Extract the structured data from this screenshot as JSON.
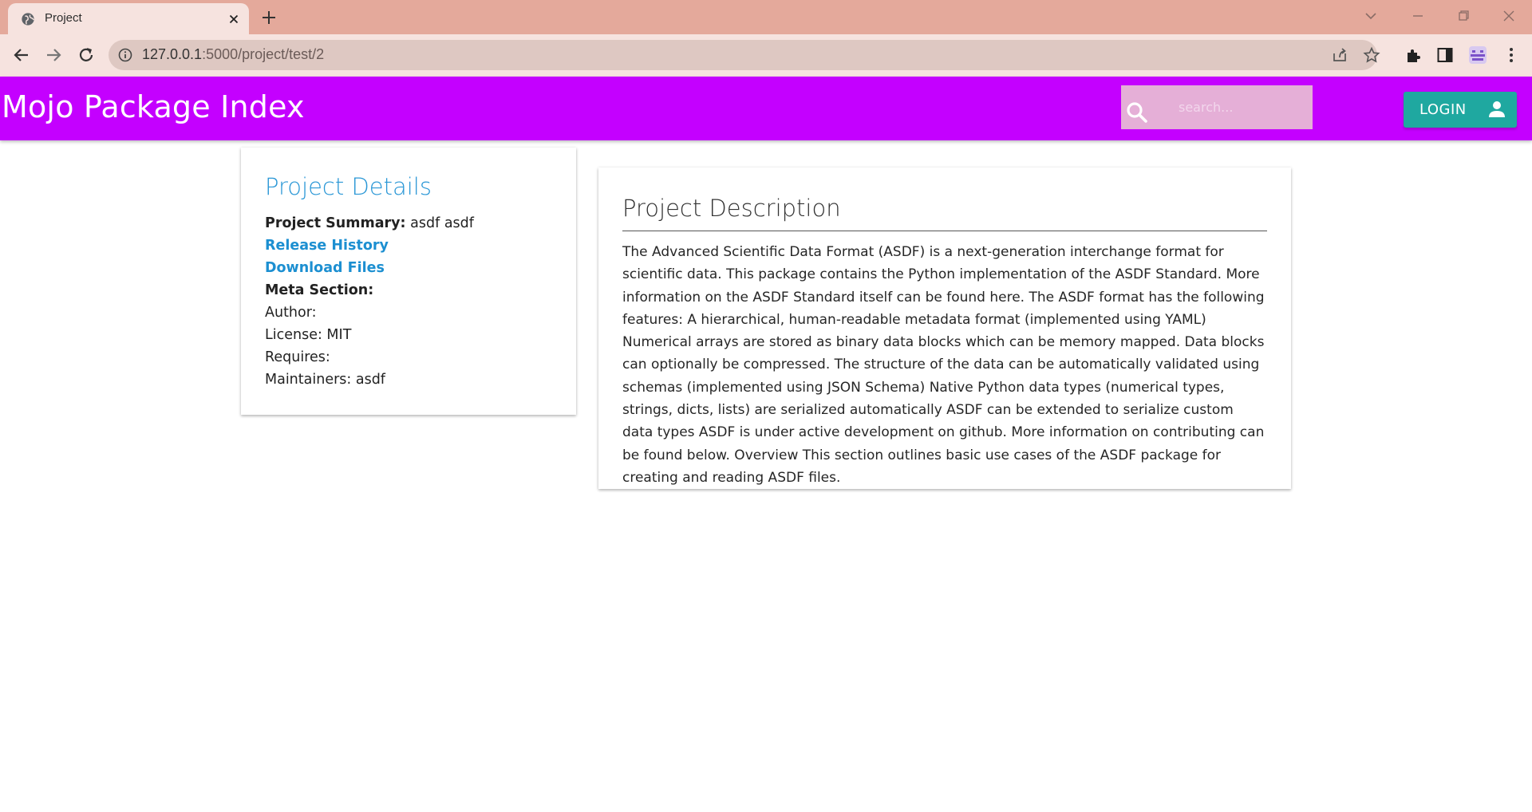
{
  "browser": {
    "tab_title": "Project",
    "url_host": "127.0.0.1",
    "url_path": ":5000/project/test/2"
  },
  "header": {
    "brand": "Mojo Package Index",
    "search_placeholder": "search...",
    "login_label": "LOGIN"
  },
  "details": {
    "title": "Project Details",
    "summary_label": "Project Summary:",
    "summary_value": "asdf asdf",
    "release_history": "Release History",
    "download_files": "Download Files",
    "meta_label": "Meta Section:",
    "author": "Author:",
    "license": "License: MIT",
    "requires": "Requires:",
    "maintainers": "Maintainers: asdf"
  },
  "description": {
    "title": "Project Description",
    "text": "The Advanced Scientific Data Format (ASDF) is a next-generation interchange format for scientific data. This package contains the Python implementation of the ASDF Standard. More information on the ASDF Standard itself can be found here. The ASDF format has the following features: A hierarchical, human-readable metadata format (implemented using YAML) Numerical arrays are stored as binary data blocks which can be memory mapped. Data blocks can optionally be compressed. The structure of the data can be automatically validated using schemas (implemented using JSON Schema) Native Python data types (numerical types, strings, dicts, lists) are serialized automatically ASDF can be extended to serialize custom data types ASDF is under active development on github. More information on contributing can be found below. Overview This section outlines basic use cases of the ASDF package for creating and reading ASDF files."
  },
  "colors": {
    "appbar": "#c400ff",
    "search_bg": "#e5afd7",
    "login_bg": "#1fa8a0",
    "link": "#1c8fd1",
    "details_title": "#2a97d6",
    "tabstrip": "#e4a99b",
    "toolbar": "#f6e3df"
  },
  "icons": {
    "favicon": "globe-icon",
    "tab_close": "close-icon",
    "new_tab": "plus-icon",
    "back": "arrow-left-icon",
    "forward": "arrow-right-icon",
    "reload": "reload-icon",
    "site_info": "info-icon",
    "share": "share-icon",
    "bookmark": "star-icon",
    "extensions": "puzzle-icon",
    "side_panel": "side-panel-icon",
    "profile": "profile-avatar-icon",
    "menu": "kebab-menu-icon",
    "search": "search-icon",
    "login": "person-icon"
  }
}
